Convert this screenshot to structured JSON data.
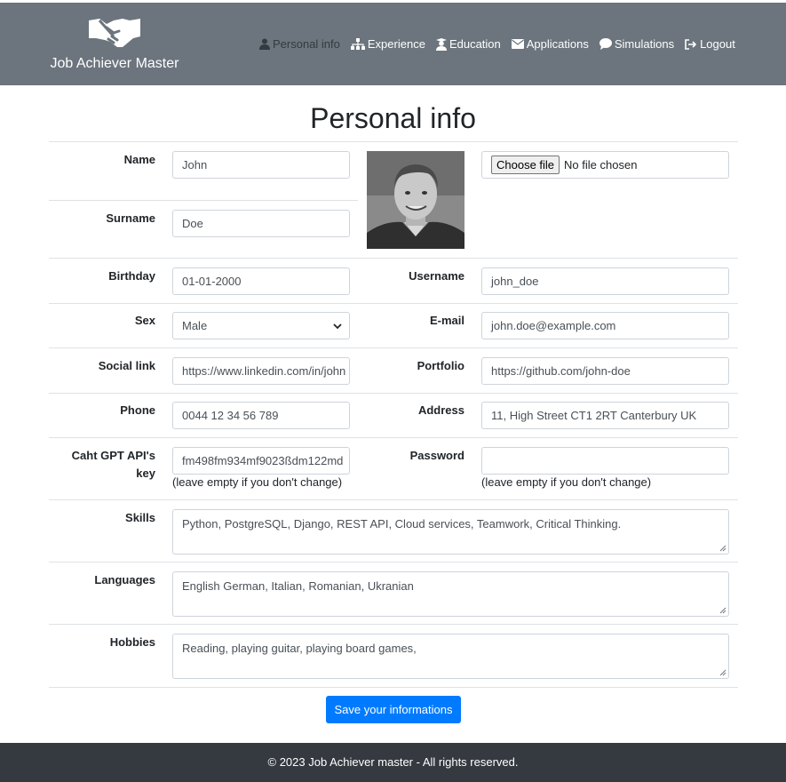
{
  "brand": {
    "name": "Job Achiever Master",
    "icon": "handshake-icon"
  },
  "nav": [
    {
      "label": "Personal info",
      "icon": "user-icon",
      "active": true
    },
    {
      "label": "Experience",
      "icon": "sitemap-icon"
    },
    {
      "label": "Education",
      "icon": "graduate-icon"
    },
    {
      "label": "Applications",
      "icon": "envelope-icon"
    },
    {
      "label": "Simulations",
      "icon": "comment-icon"
    },
    {
      "label": "Logout",
      "icon": "sign-out-icon"
    }
  ],
  "page": {
    "title": "Personal info"
  },
  "form": {
    "name": {
      "label": "Name",
      "value": "John"
    },
    "surname": {
      "label": "Surname",
      "value": "Doe"
    },
    "photo": {
      "button": "Choose file",
      "status": "No file chosen"
    },
    "birthday": {
      "label": "Birthday",
      "value": "01-01-2000"
    },
    "username": {
      "label": "Username",
      "value": "john_doe"
    },
    "sex": {
      "label": "Sex",
      "value": "Male"
    },
    "email": {
      "label": "E-mail",
      "value": "john.doe@example.com"
    },
    "social": {
      "label": "Social link",
      "value": "https://www.linkedin.com/in/john"
    },
    "portfolio": {
      "label": "Portfolio",
      "value": "https://github.com/john-doe"
    },
    "phone": {
      "label": "Phone",
      "value": "0044 12 34 56 789"
    },
    "address": {
      "label": "Address",
      "value": "11, High Street CT1 2RT Canterbury UK"
    },
    "apikey": {
      "label_line1": "Caht GPT API's",
      "label_line2": "key",
      "value": "fm498fm934mf9023ßdm122md",
      "help": "(leave empty if you don't change)"
    },
    "password": {
      "label": "Password",
      "value": "",
      "help": "(leave empty if you don't change)"
    },
    "skills": {
      "label": "Skills",
      "value": "Python, PostgreSQL, Django, REST API, Cloud services, Teamwork, Critical Thinking."
    },
    "languages": {
      "label": "Languages",
      "value": "English German, Italian, Romanian, Ukranian"
    },
    "hobbies": {
      "label": "Hobbies",
      "value": "Reading, playing guitar, playing board games,"
    },
    "save_label": "Save your informations"
  },
  "footer": {
    "text": "© 2023 Job Achiever master - All rights reserved."
  },
  "colors": {
    "navbar": "#6c757d",
    "footer": "#343a40",
    "primary": "#007bff"
  }
}
